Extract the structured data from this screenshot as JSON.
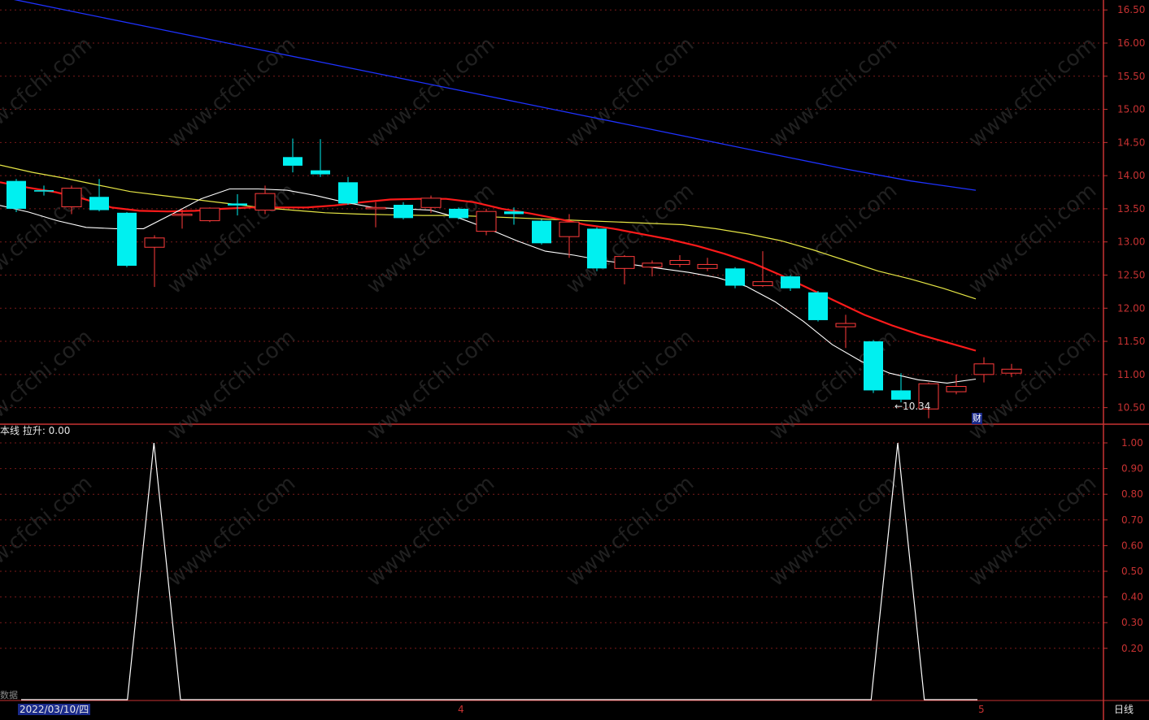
{
  "colors": {
    "up": "#ff3b3b",
    "down": "#00f0f0",
    "ma5": "#ffffff",
    "ma10": "#ff1a1a",
    "ma20": "#e6e645",
    "ma60": "#1e32ff",
    "axis": "#c83232",
    "indicator": "#ffffff"
  },
  "indicator_title": "本线  拉升: 0.00",
  "bottom_bar": {
    "date": "2022/03/10/四",
    "month_4": "4",
    "month_5": "5",
    "period": "日线",
    "data_label": "数据"
  },
  "badge": "财",
  "low_annotation": "←10.34",
  "chart_data": [
    {
      "type": "candlestick",
      "ylim": [
        10.25,
        16.65
      ],
      "y_ticks": [
        "16.50",
        "16.00",
        "15.50",
        "15.00",
        "14.50",
        "14.00",
        "13.50",
        "13.00",
        "12.50",
        "12.00",
        "11.50",
        "11.00",
        "10.50"
      ],
      "candles": [
        {
          "o": 13.92,
          "c": 13.5,
          "h": 13.95,
          "l": 13.45
        },
        {
          "o": 13.78,
          "c": 13.76,
          "h": 13.85,
          "l": 13.7
        },
        {
          "o": 13.53,
          "c": 13.81,
          "h": 13.85,
          "l": 13.42
        },
        {
          "o": 13.68,
          "c": 13.48,
          "h": 13.95,
          "l": 13.46
        },
        {
          "o": 13.44,
          "c": 12.64,
          "h": 13.45,
          "l": 12.62
        },
        {
          "o": 12.92,
          "c": 13.06,
          "h": 13.1,
          "l": 12.32
        },
        {
          "o": 13.4,
          "c": 13.42,
          "h": 13.5,
          "l": 13.2
        },
        {
          "o": 13.32,
          "c": 13.51,
          "h": 13.52,
          "l": 13.3
        },
        {
          "o": 13.58,
          "c": 13.55,
          "h": 13.72,
          "l": 13.4
        },
        {
          "o": 13.48,
          "c": 13.73,
          "h": 13.85,
          "l": 13.42
        },
        {
          "o": 14.28,
          "c": 14.15,
          "h": 14.56,
          "l": 14.05
        },
        {
          "o": 14.08,
          "c": 14.02,
          "h": 14.55,
          "l": 13.98
        },
        {
          "o": 13.9,
          "c": 13.58,
          "h": 13.98,
          "l": 13.56
        },
        {
          "o": 13.5,
          "c": 13.52,
          "h": 13.6,
          "l": 13.22
        },
        {
          "o": 13.56,
          "c": 13.36,
          "h": 13.6,
          "l": 13.34
        },
        {
          "o": 13.52,
          "c": 13.66,
          "h": 13.7,
          "l": 13.44
        },
        {
          "o": 13.5,
          "c": 13.36,
          "h": 13.52,
          "l": 13.34
        },
        {
          "o": 13.16,
          "c": 13.46,
          "h": 13.5,
          "l": 13.1
        },
        {
          "o": 13.46,
          "c": 13.42,
          "h": 13.52,
          "l": 13.26
        },
        {
          "o": 13.32,
          "c": 12.98,
          "h": 13.34,
          "l": 12.96
        },
        {
          "o": 13.08,
          "c": 13.3,
          "h": 13.42,
          "l": 12.76
        },
        {
          "o": 13.2,
          "c": 12.6,
          "h": 13.22,
          "l": 12.56
        },
        {
          "o": 12.6,
          "c": 12.78,
          "h": 12.8,
          "l": 12.36
        },
        {
          "o": 12.62,
          "c": 12.68,
          "h": 12.72,
          "l": 12.48
        },
        {
          "o": 12.66,
          "c": 12.72,
          "h": 12.8,
          "l": 12.62
        },
        {
          "o": 12.6,
          "c": 12.66,
          "h": 12.76,
          "l": 12.56
        },
        {
          "o": 12.6,
          "c": 12.34,
          "h": 12.62,
          "l": 12.3
        },
        {
          "o": 12.34,
          "c": 12.4,
          "h": 12.86,
          "l": 12.32
        },
        {
          "o": 12.48,
          "c": 12.3,
          "h": 12.5,
          "l": 12.26
        },
        {
          "o": 12.24,
          "c": 11.82,
          "h": 12.26,
          "l": 11.8
        },
        {
          "o": 11.72,
          "c": 11.77,
          "h": 11.9,
          "l": 11.4
        },
        {
          "o": 11.5,
          "c": 10.76,
          "h": 11.52,
          "l": 10.72
        },
        {
          "o": 10.76,
          "c": 10.62,
          "h": 11.02,
          "l": 10.58
        },
        {
          "o": 10.48,
          "c": 10.86,
          "h": 10.88,
          "l": 10.34
        },
        {
          "o": 10.74,
          "c": 10.82,
          "h": 11.0,
          "l": 10.7
        },
        {
          "o": 11.0,
          "c": 11.16,
          "h": 11.26,
          "l": 10.88
        },
        {
          "o": 11.02,
          "c": 11.08,
          "h": 11.16,
          "l": 10.96
        }
      ],
      "ma5": [
        13.55,
        13.45,
        13.32,
        13.22,
        13.2,
        13.2,
        13.42,
        13.65,
        13.8,
        13.8,
        13.78,
        13.7,
        13.6,
        13.52,
        13.5,
        13.48,
        13.36,
        13.2,
        13.02,
        12.86,
        12.8,
        12.72,
        12.66,
        12.6,
        12.54,
        12.46,
        12.33,
        12.1,
        11.8,
        11.45,
        11.2,
        11.02,
        10.92,
        10.87,
        10.93
      ],
      "ma10": [
        13.9,
        13.82,
        13.75,
        13.65,
        13.52,
        13.47,
        13.46,
        13.47,
        13.5,
        13.52,
        13.52,
        13.52,
        13.55,
        13.6,
        13.64,
        13.65,
        13.65,
        13.6,
        13.5,
        13.43,
        13.35,
        13.26,
        13.2,
        13.12,
        13.04,
        12.94,
        12.82,
        12.68,
        12.5,
        12.3,
        12.1,
        11.9,
        11.74,
        11.6,
        11.48,
        11.36
      ],
      "ma20": [
        14.16,
        14.05,
        13.96,
        13.86,
        13.76,
        13.7,
        13.64,
        13.58,
        13.52,
        13.48,
        13.44,
        13.42,
        13.41,
        13.4,
        13.4,
        13.38,
        13.36,
        13.34,
        13.32,
        13.3,
        13.28,
        13.26,
        13.2,
        13.12,
        13.02,
        12.88,
        12.72,
        12.56,
        12.44,
        12.3,
        12.14
      ],
      "ma60": [
        16.7,
        16.5,
        16.3,
        16.1,
        15.9,
        15.7,
        15.5,
        15.3,
        15.1,
        14.9,
        14.7,
        14.5,
        14.3,
        14.1,
        13.92,
        13.78
      ]
    },
    {
      "type": "line",
      "title": "本线  拉升",
      "ylim": [
        0,
        1.05
      ],
      "y_ticks": [
        "1.00",
        "0.90",
        "0.80",
        "0.70",
        "0.60",
        "0.50",
        "0.40",
        "0.30",
        "0.20"
      ],
      "series": [
        {
          "values": [
            0,
            0,
            0,
            0,
            0,
            1,
            0,
            0,
            0,
            0,
            0,
            0,
            0,
            0,
            0,
            0,
            0,
            0,
            0,
            0,
            0,
            0,
            0,
            0,
            0,
            0,
            0,
            0,
            0,
            0,
            0,
            0,
            0,
            1,
            0,
            0,
            0
          ]
        }
      ]
    }
  ]
}
